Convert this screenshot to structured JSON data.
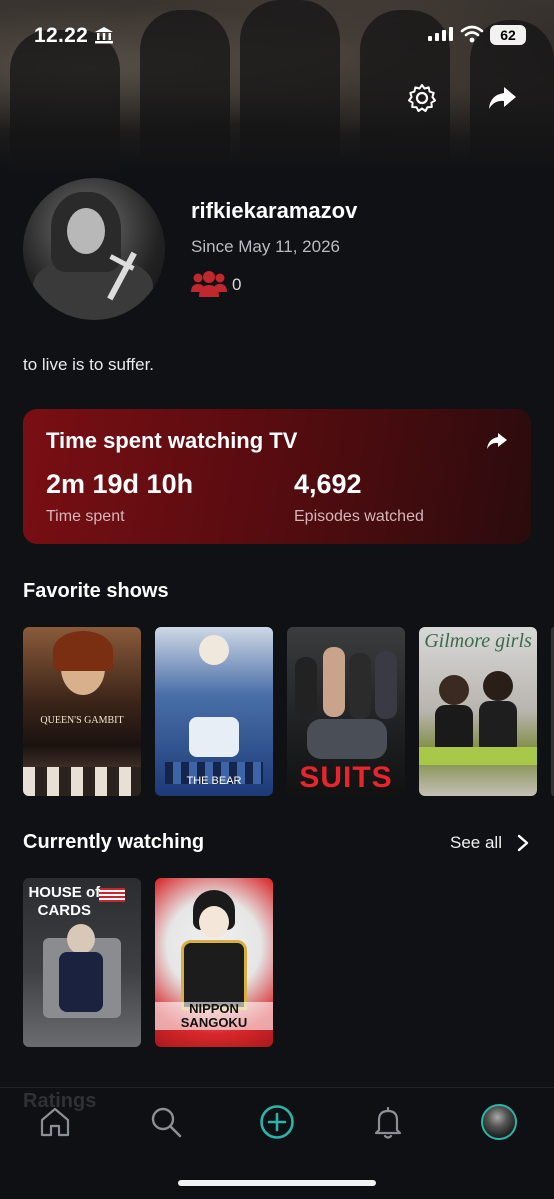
{
  "status_bar": {
    "time": "12.22",
    "battery": "62"
  },
  "profile": {
    "username": "rifkiekaramazov",
    "since": "Since May 11, 2026",
    "followers": "0",
    "bio": "to live is to suffer."
  },
  "stats": {
    "title": "Time spent watching TV",
    "time_value": "2m 19d 10h",
    "time_label": "Time spent",
    "episodes_value": "4,692",
    "episodes_label": "Episodes watched"
  },
  "favorites": {
    "title": "Favorite shows",
    "shows": [
      {
        "poster_text": "QUEEN'S GAMBIT"
      },
      {
        "poster_text": "THE BEAR"
      },
      {
        "poster_text": "SUITS"
      },
      {
        "poster_text": "Gilmore girls"
      }
    ]
  },
  "currently_watching": {
    "title": "Currently watching",
    "see_all": "See all",
    "shows": [
      {
        "poster_text": "HOUSE of CARDS"
      },
      {
        "poster_text": "NIPPON SANGOKU"
      }
    ]
  },
  "ratings_peek": "Ratings",
  "tabs": [
    {
      "icon": "home-icon"
    },
    {
      "icon": "search-icon"
    },
    {
      "icon": "add-circle-icon"
    },
    {
      "icon": "bell-icon"
    },
    {
      "icon": "profile-avatar"
    }
  ],
  "colors": {
    "accent": "#2bb5a8",
    "card_red": "#7a0f14",
    "follower_red": "#c0282d"
  }
}
